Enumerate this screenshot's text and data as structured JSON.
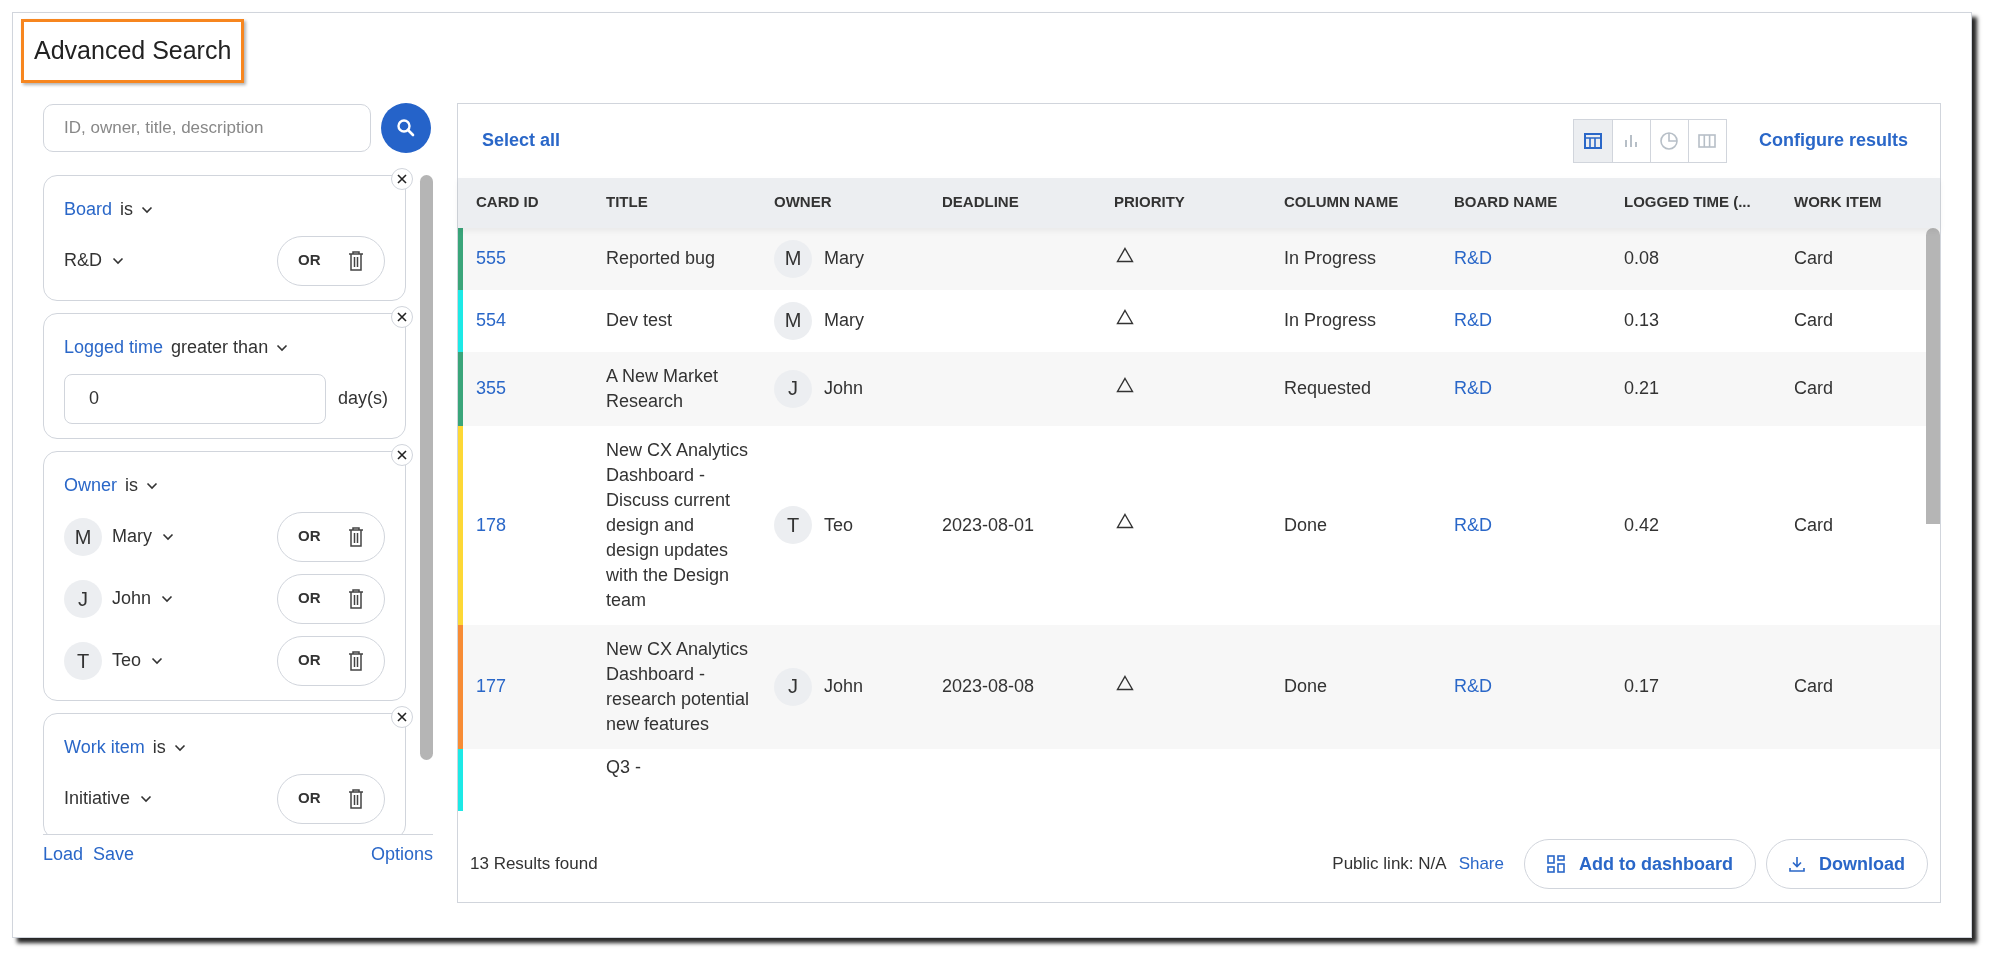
{
  "title": "Advanced Search",
  "search": {
    "placeholder": "ID, owner, title, description"
  },
  "filters": [
    {
      "field": "Board",
      "operator": "is",
      "kind": "values",
      "values": [
        {
          "label": "R&D",
          "join": "OR"
        }
      ]
    },
    {
      "field": "Logged time",
      "operator": "greater than",
      "kind": "number",
      "value": "0",
      "unit": "day(s)"
    },
    {
      "field": "Owner",
      "operator": "is",
      "kind": "values",
      "values": [
        {
          "initial": "M",
          "label": "Mary",
          "join": "OR"
        },
        {
          "initial": "J",
          "label": "John",
          "join": "OR"
        },
        {
          "initial": "T",
          "label": "Teo",
          "join": "OR"
        }
      ]
    },
    {
      "field": "Work item",
      "operator": "is",
      "kind": "values",
      "values": [
        {
          "label": "Initiative",
          "join": "OR"
        }
      ]
    }
  ],
  "filter_footer": {
    "load": "Load",
    "save": "Save",
    "options": "Options"
  },
  "results": {
    "select_all": "Select all",
    "views": [
      {
        "kind": "table",
        "selected": true
      },
      {
        "kind": "bar",
        "selected": false
      },
      {
        "kind": "pie",
        "selected": false
      },
      {
        "kind": "columns",
        "selected": false
      }
    ],
    "configure": "Configure results",
    "columns": [
      "CARD ID",
      "TITLE",
      "OWNER",
      "DEADLINE",
      "PRIORITY",
      "COLUMN NAME",
      "BOARD NAME",
      "LOGGED TIME (...",
      "WORK ITEM"
    ],
    "rows": [
      {
        "color": "#3aa57a",
        "card_id": "555",
        "title": "Reported bug",
        "owner_initial": "M",
        "owner": "Mary",
        "deadline": "",
        "column_name": "In Progress",
        "board": "R&D",
        "logged_time": "0.08",
        "work_item": "Card"
      },
      {
        "color": "#1de9e6",
        "card_id": "554",
        "title": "Dev test",
        "owner_initial": "M",
        "owner": "Mary",
        "deadline": "",
        "column_name": "In Progress",
        "board": "R&D",
        "logged_time": "0.13",
        "work_item": "Card"
      },
      {
        "color": "#3aa57a",
        "card_id": "355",
        "title": "A New Market Research",
        "owner_initial": "J",
        "owner": "John",
        "deadline": "",
        "column_name": "Requested",
        "board": "R&D",
        "logged_time": "0.21",
        "work_item": "Card"
      },
      {
        "color": "#fdd835",
        "card_id": "178",
        "title": "New CX Analytics Dashboard - Discuss current design and design updates with the Design team",
        "owner_initial": "T",
        "owner": "Teo",
        "deadline": "2023-08-01",
        "column_name": "Done",
        "board": "R&D",
        "logged_time": "0.42",
        "work_item": "Card"
      },
      {
        "color": "#f78c35",
        "card_id": "177",
        "title": "New CX Analytics Dashboard - research potential new features",
        "owner_initial": "J",
        "owner": "John",
        "deadline": "2023-08-08",
        "column_name": "Done",
        "board": "R&D",
        "logged_time": "0.17",
        "work_item": "Card"
      },
      {
        "color": "#1de9e6",
        "title": "Q3 -"
      }
    ],
    "count": "13 Results found",
    "public_link": "Public link: N/A",
    "share": "Share",
    "add_to_dashboard": "Add to dashboard",
    "download": "Download"
  }
}
